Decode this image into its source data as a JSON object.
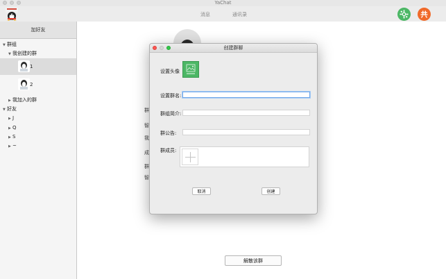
{
  "window": {
    "title": "YaChat"
  },
  "toolbar": {
    "tab_messages": "消息",
    "tab_contacts": "通讯录"
  },
  "sidebar": {
    "add_friend": "加好友",
    "groups_section": "群组",
    "my_created_groups": "我创建的群",
    "created_members": [
      {
        "name": "1"
      },
      {
        "name": "2"
      }
    ],
    "joined_groups": "我加入的群",
    "friends_section": "好友",
    "friends": [
      {
        "label": "J"
      },
      {
        "label": "Q"
      },
      {
        "label": "S"
      },
      {
        "label": "~"
      }
    ]
  },
  "main": {
    "bg_labels": [
      "群",
      "智",
      "我",
      "成",
      "群",
      "智"
    ],
    "dissolve_button": "解散该群"
  },
  "dialog": {
    "title": "创建群聊",
    "avatar_label": "设置头像",
    "name_label": "设置群名:",
    "name_value": "",
    "intro_label": "群组简介:",
    "intro_value": "",
    "notice_label": "群公告:",
    "notice_value": "",
    "members_label": "群成员:",
    "cancel": "取消",
    "create": "创建"
  },
  "colors": {
    "green_icon": "#4cb765",
    "orange_icon": "#f06a2a",
    "focus_border": "#6fa6e8",
    "close_dot": "#fc5753",
    "min_dot": "#d7d7d7",
    "zoom_dot": "#34c84a"
  },
  "icons": {
    "app_logo": "penguin-logo-icon",
    "green_button": "puzzle-icon",
    "orange_button": "share-icon",
    "avatar": "penguin-avatar-icon",
    "group_avatar": "image-placeholder-icon",
    "members_add": "plus-icon"
  }
}
